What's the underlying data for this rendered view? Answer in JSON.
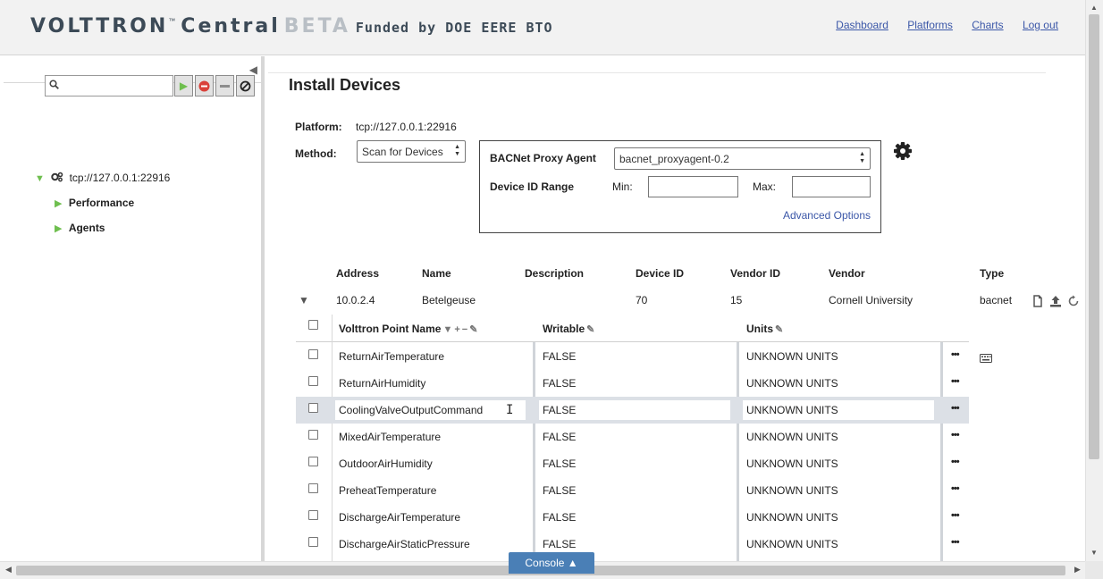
{
  "header": {
    "logo_main": "VOLTTRON",
    "logo_tm": "™",
    "logo_central": "Central",
    "logo_beta": "BETA",
    "logo_funded": "Funded by DOE EERE BTO",
    "nav": [
      "Dashboard",
      "Platforms",
      "Charts",
      "Log out"
    ]
  },
  "sidebar": {
    "search": {
      "value": "",
      "placeholder": ""
    },
    "tree": {
      "platform": "tcp://127.0.0.1:22916",
      "children": [
        "Performance",
        "Agents"
      ]
    }
  },
  "main": {
    "title": "Install Devices",
    "platform_label": "Platform:",
    "platform_value": "tcp://127.0.0.1:22916",
    "method_label": "Method:",
    "method_value": "Scan for Devices",
    "bacnet": {
      "proxy_label": "BACNet Proxy Agent",
      "proxy_value": "bacnet_proxyagent-0.2",
      "range_label": "Device ID Range",
      "min_label": "Min:",
      "max_label": "Max:",
      "min_value": "",
      "max_value": "",
      "advanced": "Advanced Options"
    },
    "devices": {
      "columns": [
        "Address",
        "Name",
        "Description",
        "Device ID",
        "Vendor ID",
        "Vendor",
        "Type"
      ],
      "rows": [
        {
          "address": "10.0.2.4",
          "name": "Betelgeuse",
          "description": "",
          "device_id": "70",
          "vendor_id": "15",
          "vendor": "Cornell University",
          "type": "bacnet"
        }
      ]
    },
    "points": {
      "columns": [
        "Volttron Point Name",
        "Writable",
        "Units"
      ],
      "rows": [
        {
          "name": "ReturnAirTemperature",
          "writable": "FALSE",
          "units": "UNKNOWN UNITS"
        },
        {
          "name": "ReturnAirHumidity",
          "writable": "FALSE",
          "units": "UNKNOWN UNITS"
        },
        {
          "name": "CoolingValveOutputCommand",
          "writable": "FALSE",
          "units": "UNKNOWN UNITS"
        },
        {
          "name": "MixedAirTemperature",
          "writable": "FALSE",
          "units": "UNKNOWN UNITS"
        },
        {
          "name": "OutdoorAirHumidity",
          "writable": "FALSE",
          "units": "UNKNOWN UNITS"
        },
        {
          "name": "PreheatTemperature",
          "writable": "FALSE",
          "units": "UNKNOWN UNITS"
        },
        {
          "name": "DischargeAirTemperature",
          "writable": "FALSE",
          "units": "UNKNOWN UNITS"
        },
        {
          "name": "DischargeAirStaticPressure",
          "writable": "FALSE",
          "units": "UNKNOWN UNITS"
        }
      ],
      "row_menu": "•••"
    }
  },
  "console": {
    "label": "Console ▲"
  },
  "colors": {
    "accent_blue": "#4a7fb6",
    "link": "#3b57a8",
    "tree_green": "#6fbf4f",
    "selected_row": "#dce0e6"
  }
}
